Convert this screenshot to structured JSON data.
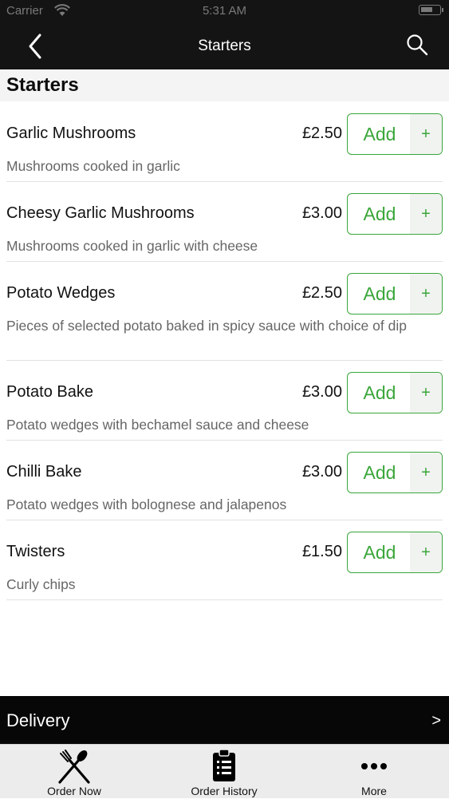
{
  "status_bar": {
    "carrier": "Carrier",
    "time": "5:31 AM"
  },
  "nav": {
    "title": "Starters"
  },
  "section": {
    "title": "Starters"
  },
  "items": [
    {
      "name": "Garlic Mushrooms",
      "price": "£2.50",
      "description": "Mushrooms cooked in garlic",
      "add_label": "Add",
      "plus": "+"
    },
    {
      "name": "Cheesy Garlic Mushrooms",
      "price": "£3.00",
      "description": "Mushrooms cooked in garlic with cheese",
      "add_label": "Add",
      "plus": "+"
    },
    {
      "name": "Potato Wedges",
      "price": "£2.50",
      "description": "Pieces of selected potato baked in spicy sauce with choice of dip",
      "add_label": "Add",
      "plus": "+"
    },
    {
      "name": "Potato Bake",
      "price": "£3.00",
      "description": "Potato wedges with bechamel sauce and cheese",
      "add_label": "Add",
      "plus": "+"
    },
    {
      "name": "Chilli Bake",
      "price": "£3.00",
      "description": "Potato wedges with bolognese and jalapenos",
      "add_label": "Add",
      "plus": "+"
    },
    {
      "name": "Twisters",
      "price": "£1.50",
      "description": "Curly chips",
      "add_label": "Add",
      "plus": "+"
    }
  ],
  "delivery": {
    "label": "Delivery",
    "arrow": ">"
  },
  "tabs": [
    {
      "label": "Order Now",
      "icon": "fork-knife-icon"
    },
    {
      "label": "Order History",
      "icon": "clipboard-list-icon"
    },
    {
      "label": "More",
      "icon": "more-dots-icon"
    }
  ],
  "colors": {
    "accent": "#3aa63a",
    "topbar": "#141414",
    "delivery_bar": "#070707",
    "tabbar": "#ececec"
  }
}
